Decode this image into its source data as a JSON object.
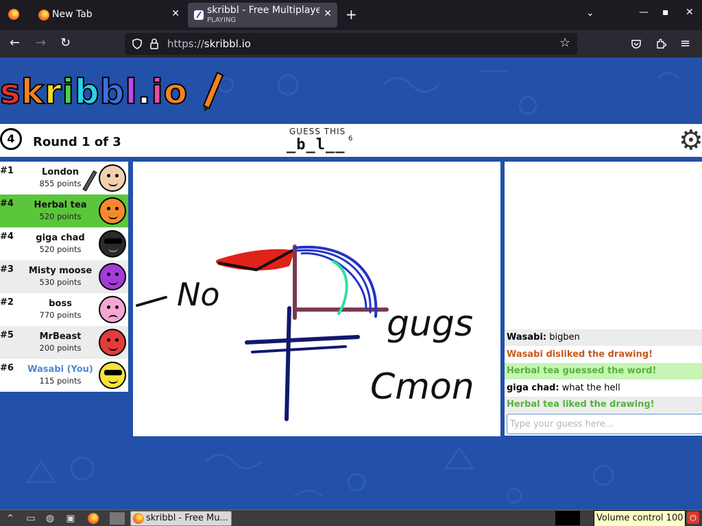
{
  "browser": {
    "tabs": [
      {
        "title": "New Tab",
        "subtitle": ""
      },
      {
        "title": "skribbl - Free Multiplayer",
        "subtitle": "PLAYING"
      }
    ],
    "url_scheme": "https://",
    "url_host": "skribbl.io"
  },
  "game": {
    "logo": [
      "s",
      "k",
      "r",
      "i",
      "b",
      "b",
      "l",
      ".",
      "i",
      "o"
    ],
    "logo_colors": [
      "#e8312c",
      "#f4831e",
      "#f8d627",
      "#4cd442",
      "#2ad1e6",
      "#3b6fe0",
      "#b84ce8",
      "#ffffff",
      "#e84ca6",
      "#f4831e"
    ],
    "timer": "4",
    "round_text": "Round 1 of 3",
    "guess_label": "GUESS THIS",
    "word_hint": "_b_l__",
    "word_length": "6",
    "players": [
      {
        "rank": "#1",
        "name": "London",
        "points": "855 points",
        "color": "#f3d1b0",
        "style": "normal",
        "drawing": true
      },
      {
        "rank": "#4",
        "name": "Herbal tea",
        "points": "520 points",
        "color": "#f58a2b",
        "style": "guessed"
      },
      {
        "rank": "#4",
        "name": "giga chad",
        "points": "520 points",
        "color": "#2a2a2a",
        "style": "normal"
      },
      {
        "rank": "#3",
        "name": "Misty moose",
        "points": "530 points",
        "color": "#a43bd6",
        "style": "alt"
      },
      {
        "rank": "#2",
        "name": "boss",
        "points": "770 points",
        "color": "#f4a6d2",
        "style": "normal"
      },
      {
        "rank": "#5",
        "name": "MrBeast",
        "points": "200 points",
        "color": "#e23b3b",
        "style": "alt"
      },
      {
        "rank": "#6",
        "name": "Wasabi (You)",
        "points": "115 points",
        "color": "#f7e13a",
        "style": "me"
      }
    ],
    "chat": [
      {
        "user": "Wasabi:",
        "text": "bigben",
        "kind": "user",
        "bg": "gray"
      },
      {
        "user": "",
        "text": "Wasabi disliked the drawing!",
        "kind": "sys-orange",
        "bg": "white"
      },
      {
        "user": "",
        "text": "Herbal tea guessed the word!",
        "kind": "sys-green",
        "bg": "green"
      },
      {
        "user": "giga chad:",
        "text": "what the hell",
        "kind": "user",
        "bg": "white"
      },
      {
        "user": "",
        "text": "Herbal tea liked the drawing!",
        "kind": "sys-green",
        "bg": "gray"
      }
    ],
    "chat_placeholder": "Type your guess here...",
    "canvas_text": [
      "No",
      "gugs",
      "Cmon"
    ]
  },
  "taskbar": {
    "window_title": "skribbl - Free Mu...",
    "volume": "Volume control 100"
  }
}
